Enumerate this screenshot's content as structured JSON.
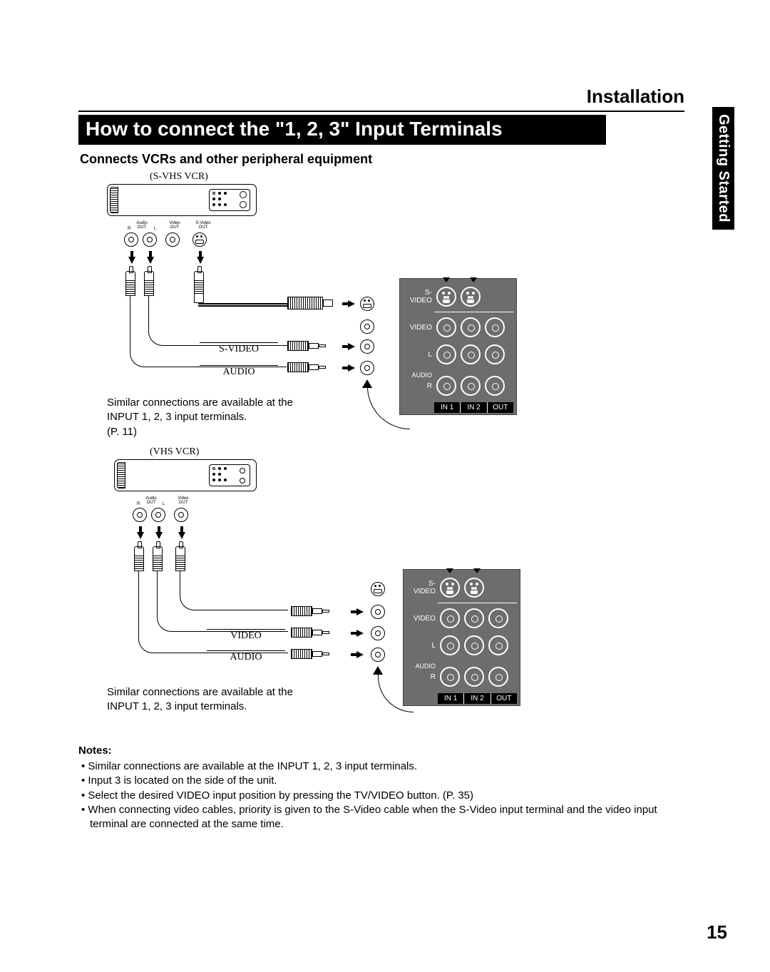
{
  "header": {
    "section": "Installation"
  },
  "sideTab": "Getting Started",
  "title": "How to connect the \"1, 2, 3\" Input Terminals",
  "subtitle": "Connects VCRs and other peripheral equipment",
  "diagram1": {
    "vcrLabel": "(S-VHS VCR)",
    "outLabels": {
      "audio": "Audio\nOUT",
      "r": "R",
      "l": "L",
      "video": "Video\nOUT",
      "svideo": "S-Video\nOUT"
    },
    "cableSvideo": "S-VIDEO",
    "cableAudio": "AUDIO",
    "note": "Similar connections are available at the INPUT 1, 2, 3 input terminals.\n(P. 11)"
  },
  "diagram2": {
    "vcrLabel": "(VHS VCR)",
    "outLabels": {
      "audio": "Audio\nOUT",
      "r": "R",
      "l": "L",
      "video": "Video\nOUT"
    },
    "cableVideo": "VIDEO",
    "cableAudio": "AUDIO",
    "note": "Similar connections are available at the INPUT 1, 2, 3 input terminals."
  },
  "panel": {
    "svideo": "S-VIDEO",
    "video": "VIDEO",
    "l": "L",
    "audio": "AUDIO",
    "r": "R",
    "in1": "IN 1",
    "in2": "IN 2",
    "out": "OUT"
  },
  "notes": {
    "heading": "Notes:",
    "items": [
      "Similar connections are available at the INPUT 1, 2, 3 input terminals.",
      "Input 3 is located on the side of the unit.",
      "Select the desired VIDEO input position by pressing the TV/VIDEO button. (P. 35)",
      "When connecting video cables, priority is given to the S-Video cable when the S-Video input terminal and the video input terminal are connected at the same time."
    ]
  },
  "pageNumber": "15"
}
